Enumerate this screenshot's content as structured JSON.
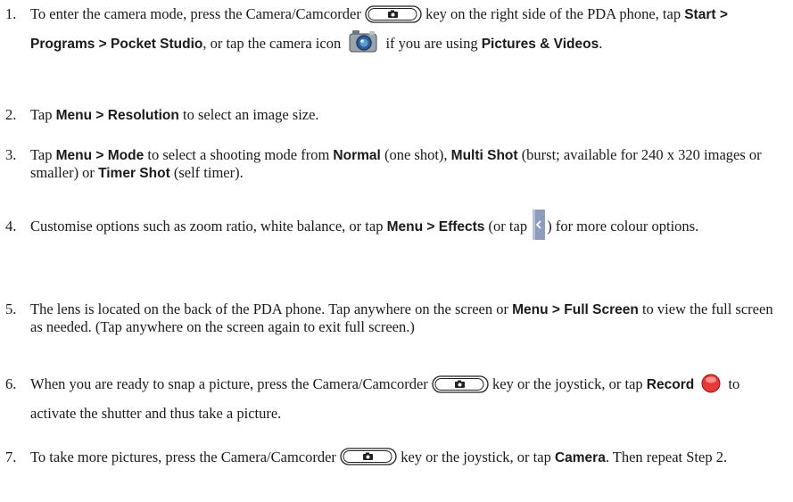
{
  "steps": [
    {
      "num": "1.",
      "parts": [
        {
          "t": "To enter the camera mode, press the Camera/Camcorder "
        },
        {
          "icon": "camera-key-icon"
        },
        {
          "t": " key on the right side of the PDA phone, tap "
        },
        {
          "b": "Start > Programs > Pocket Studio"
        },
        {
          "t": ", or tap the camera icon "
        },
        {
          "icon": "camera-app-icon"
        },
        {
          "t": " if you are using "
        },
        {
          "b": "Pictures & Videos"
        },
        {
          "t": "."
        }
      ]
    },
    {
      "num": "2.",
      "parts": [
        {
          "t": "Tap "
        },
        {
          "b": "Menu > Resolution"
        },
        {
          "t": " to select an image size."
        }
      ]
    },
    {
      "num": "3.",
      "parts": [
        {
          "t": "Tap "
        },
        {
          "b": "Menu > Mode"
        },
        {
          "t": " to select a shooting mode from "
        },
        {
          "b": "Normal"
        },
        {
          "t": " (one shot), "
        },
        {
          "b": "Multi Shot"
        },
        {
          "t": " (burst; available for 240 x 320 images or smaller) or "
        },
        {
          "b": "Timer Shot"
        },
        {
          "t": " (self timer)."
        }
      ]
    },
    {
      "num": "4.",
      "parts": [
        {
          "t": "Customise options such as zoom ratio, white balance, or tap "
        },
        {
          "b": "Menu > Effects"
        },
        {
          "t": " (or tap "
        },
        {
          "icon": "chevron-left-icon"
        },
        {
          "t": ") for more colour options."
        }
      ]
    },
    {
      "num": "5.",
      "parts": [
        {
          "t": "The lens is located on the back of the PDA phone. Tap anywhere on the screen or "
        },
        {
          "b": "Menu > Full Screen"
        },
        {
          "t": " to view the full screen as needed. (Tap anywhere on the screen again to exit full screen.)"
        }
      ]
    },
    {
      "num": "6.",
      "parts": [
        {
          "t": "When you are ready to snap a picture, press the Camera/Camcorder "
        },
        {
          "icon": "camera-key-icon"
        },
        {
          "t": " key or the joystick, or tap "
        },
        {
          "b": "Record"
        },
        {
          "t": " "
        },
        {
          "icon": "record-icon"
        },
        {
          "t": " to activate the shutter and thus take a picture."
        }
      ]
    },
    {
      "num": "7.",
      "parts": [
        {
          "t": "To take more pictures, press the Camera/Camcorder "
        },
        {
          "icon": "camera-key-icon"
        },
        {
          "t": " key or the joystick, or tap "
        },
        {
          "b": "Camera"
        },
        {
          "t": ". Then repeat Step 2."
        }
      ]
    }
  ]
}
